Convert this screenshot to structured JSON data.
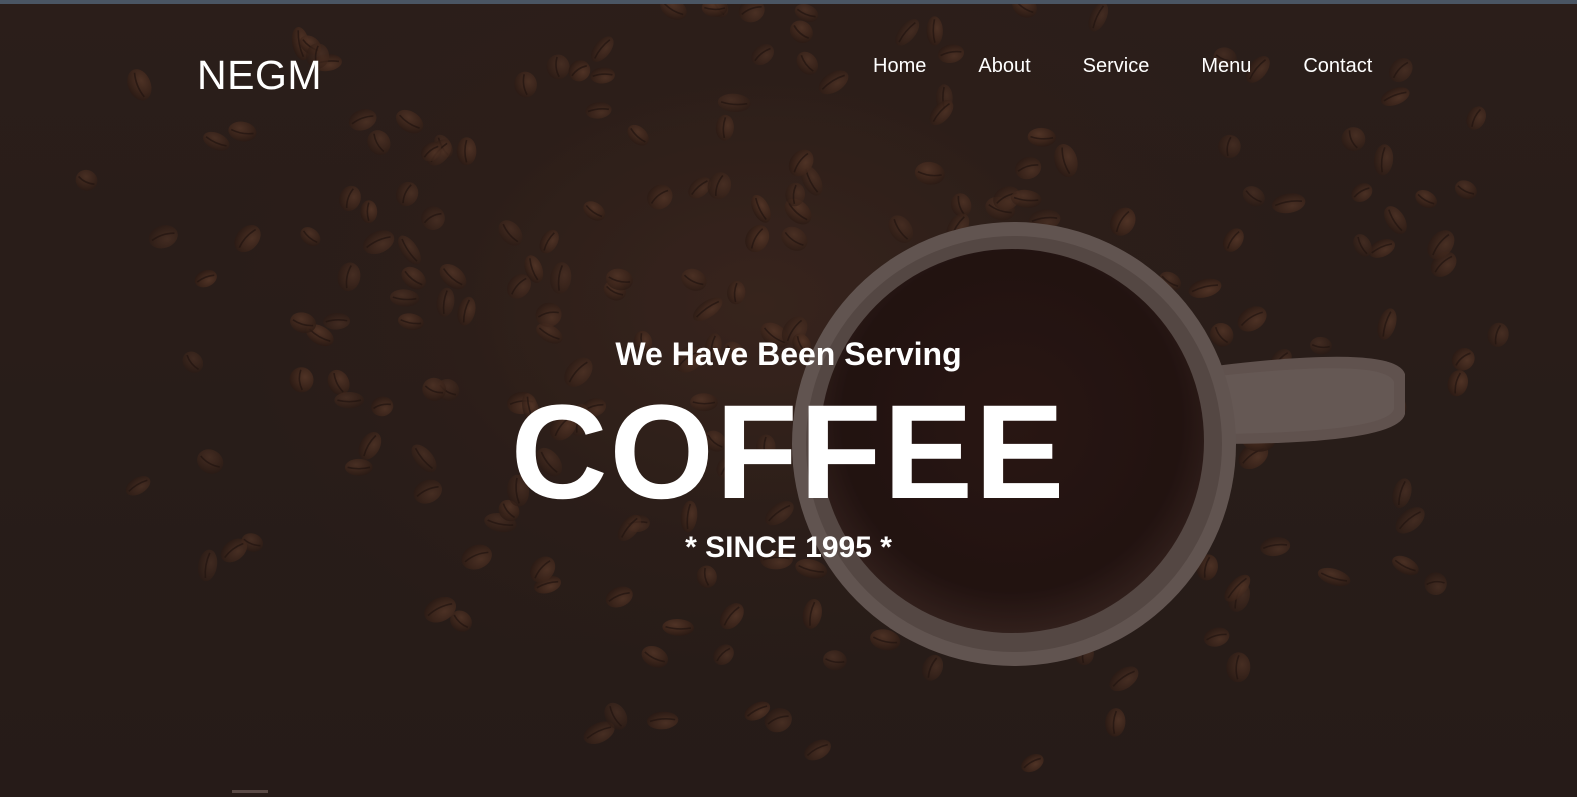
{
  "brand": {
    "logo_text": "NEGM"
  },
  "nav": {
    "items": [
      {
        "label": "Home"
      },
      {
        "label": "About"
      },
      {
        "label": "Service"
      },
      {
        "label": "Menu"
      },
      {
        "label": "Contact"
      }
    ]
  },
  "hero": {
    "subtitle": "We Have Been Serving",
    "headline": "COFFEE",
    "since": "* SINCE 1995 *"
  },
  "colors": {
    "background": "#2b1d1a",
    "text": "#ffffff",
    "top_strip": "#4a5563"
  }
}
